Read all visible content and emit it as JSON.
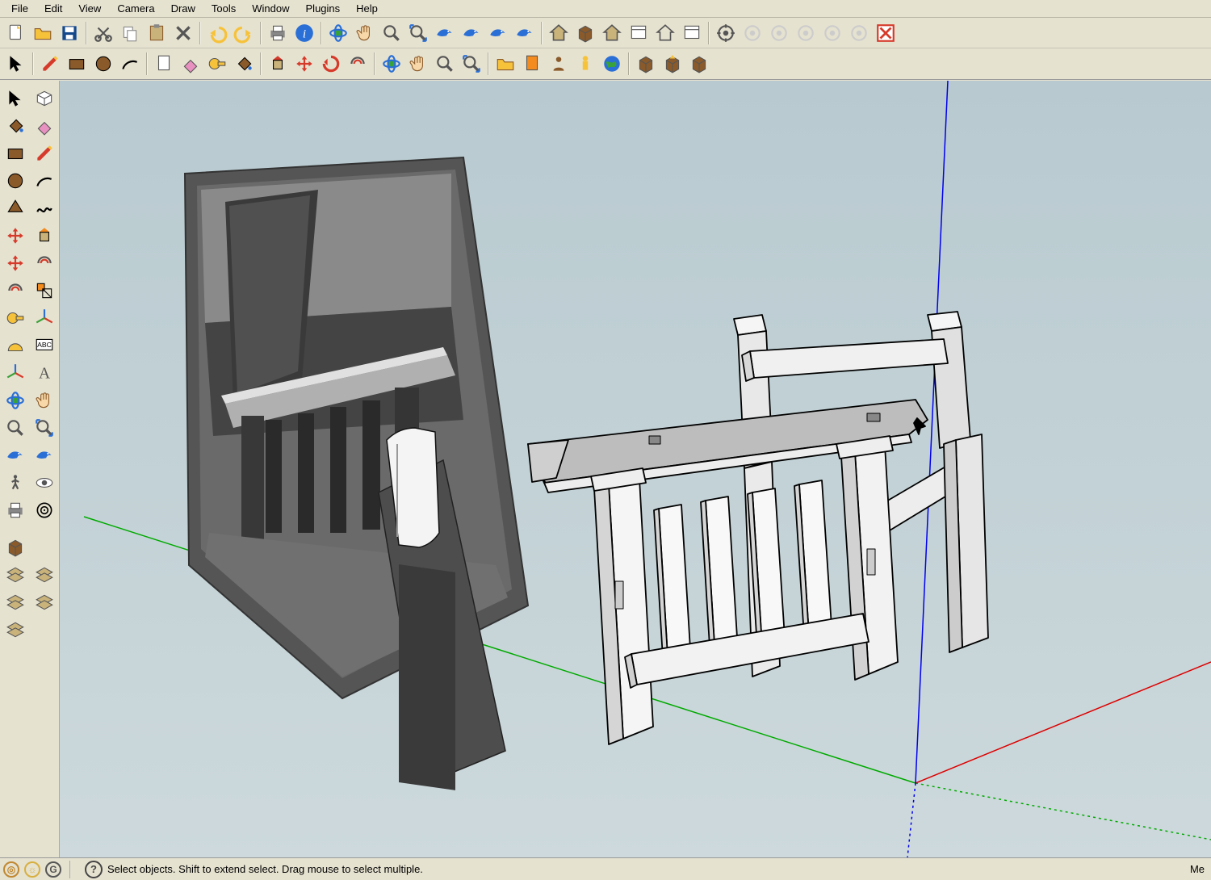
{
  "menu": [
    "File",
    "Edit",
    "View",
    "Camera",
    "Draw",
    "Tools",
    "Window",
    "Plugins",
    "Help"
  ],
  "status": {
    "hint": "Select objects. Shift to extend select. Drag mouse to select multiple.",
    "right": "Me"
  },
  "bottom_buttons": [
    "deep-red",
    "light",
    "grey"
  ],
  "left_tools_rows": [
    [
      "select-arrow-icon",
      "iso-view-icon"
    ],
    [
      "paint-bucket-icon",
      "eraser-pink-icon"
    ],
    [
      "rectangle-fill-icon",
      "line-pencil-icon"
    ],
    [
      "circle-fill-icon",
      "arc-icon"
    ],
    [
      "polygon-fill-icon",
      "freehand-icon"
    ],
    [
      "rotate-red-icon",
      "push-pull-orange-icon"
    ],
    [
      "rotate-red-2-icon",
      "follow-me-icon"
    ],
    [
      "offset-icon",
      "scale-orange-icon"
    ],
    [
      "tape-measure-icon",
      "axes-tool-icon"
    ],
    [
      "protractor-icon",
      "text-abc-icon"
    ],
    [
      "axes-star-icon",
      "text-a-icon"
    ],
    [
      "orbit-blue-icon",
      "pan-hand-icon"
    ],
    [
      "zoom-icon",
      "zoom-extents-icon"
    ],
    [
      "dolphin-icon",
      "dolphin-2-icon"
    ],
    [
      "walk-icon",
      "eye-look-icon"
    ],
    [
      "footprints-icon",
      "target-icon"
    ]
  ],
  "left_tools_lower": [
    [
      "box-brown-icon",
      ""
    ],
    [
      "layers-1-icon",
      "layers-2-icon"
    ],
    [
      "layers-3-icon",
      "layers-4-icon"
    ],
    [
      "layers-5-icon",
      ""
    ]
  ],
  "toolbar_row1": [
    {
      "n": "new-file-icon",
      "sep": false
    },
    {
      "n": "open-folder-icon"
    },
    {
      "n": "save-disk-icon"
    },
    {
      "n": "sep",
      "sep": true
    },
    {
      "n": "cut-scissors-icon"
    },
    {
      "n": "copy-icon"
    },
    {
      "n": "paste-icon"
    },
    {
      "n": "delete-x-icon"
    },
    {
      "n": "sep",
      "sep": true
    },
    {
      "n": "undo-icon"
    },
    {
      "n": "redo-icon"
    },
    {
      "n": "sep",
      "sep": true
    },
    {
      "n": "print-icon"
    },
    {
      "n": "info-blue-icon"
    },
    {
      "n": "sep",
      "sep": true
    },
    {
      "n": "orbit-nav-icon"
    },
    {
      "n": "pan-nav-icon"
    },
    {
      "n": "zoom-nav-icon"
    },
    {
      "n": "zoom-window-icon"
    },
    {
      "n": "dolphin-prev-icon"
    },
    {
      "n": "dolphin-next-icon"
    },
    {
      "n": "dolphin-3-icon"
    },
    {
      "n": "dolphin-4-icon"
    },
    {
      "n": "sep",
      "sep": true
    },
    {
      "n": "house-model-icon"
    },
    {
      "n": "box-model-icon"
    },
    {
      "n": "home-small-icon"
    },
    {
      "n": "window-1-icon"
    },
    {
      "n": "home-outline-icon"
    },
    {
      "n": "window-2-icon"
    },
    {
      "n": "sep",
      "sep": true
    },
    {
      "n": "target-circle-icon"
    },
    {
      "n": "gear-grey-icon"
    },
    {
      "n": "lock-grey-icon"
    },
    {
      "n": "wrench-grey-icon"
    },
    {
      "n": "plane-grey-icon"
    },
    {
      "n": "plane-grey-2-icon"
    },
    {
      "n": "cancel-red-icon"
    }
  ],
  "toolbar_row2": [
    {
      "n": "select-tool-icon"
    },
    {
      "n": "sep",
      "sep": true
    },
    {
      "n": "pencil-red-icon"
    },
    {
      "n": "rect-tool-icon"
    },
    {
      "n": "circle-tool-icon"
    },
    {
      "n": "arc-tool-icon"
    },
    {
      "n": "sep",
      "sep": true
    },
    {
      "n": "page-icon"
    },
    {
      "n": "eraser-tool-icon"
    },
    {
      "n": "tape-tool-icon"
    },
    {
      "n": "paint-tool-icon"
    },
    {
      "n": "sep",
      "sep": true
    },
    {
      "n": "push-red-icon"
    },
    {
      "n": "move-red-icon"
    },
    {
      "n": "rotate-tool-icon"
    },
    {
      "n": "offset-tool-icon"
    },
    {
      "n": "sep",
      "sep": true
    },
    {
      "n": "orbit-tool-icon"
    },
    {
      "n": "pan-tool-icon"
    },
    {
      "n": "zoom-tool-icon"
    },
    {
      "n": "zoom-ext-tool-icon"
    },
    {
      "n": "sep",
      "sep": true
    },
    {
      "n": "folder-yellow-icon"
    },
    {
      "n": "page-orange-icon"
    },
    {
      "n": "person-icon"
    },
    {
      "n": "figure-yellow-icon"
    },
    {
      "n": "earth-icon"
    },
    {
      "n": "sep",
      "sep": true
    },
    {
      "n": "box-out-icon"
    },
    {
      "n": "box-up-icon"
    },
    {
      "n": "box-misc-icon"
    }
  ]
}
